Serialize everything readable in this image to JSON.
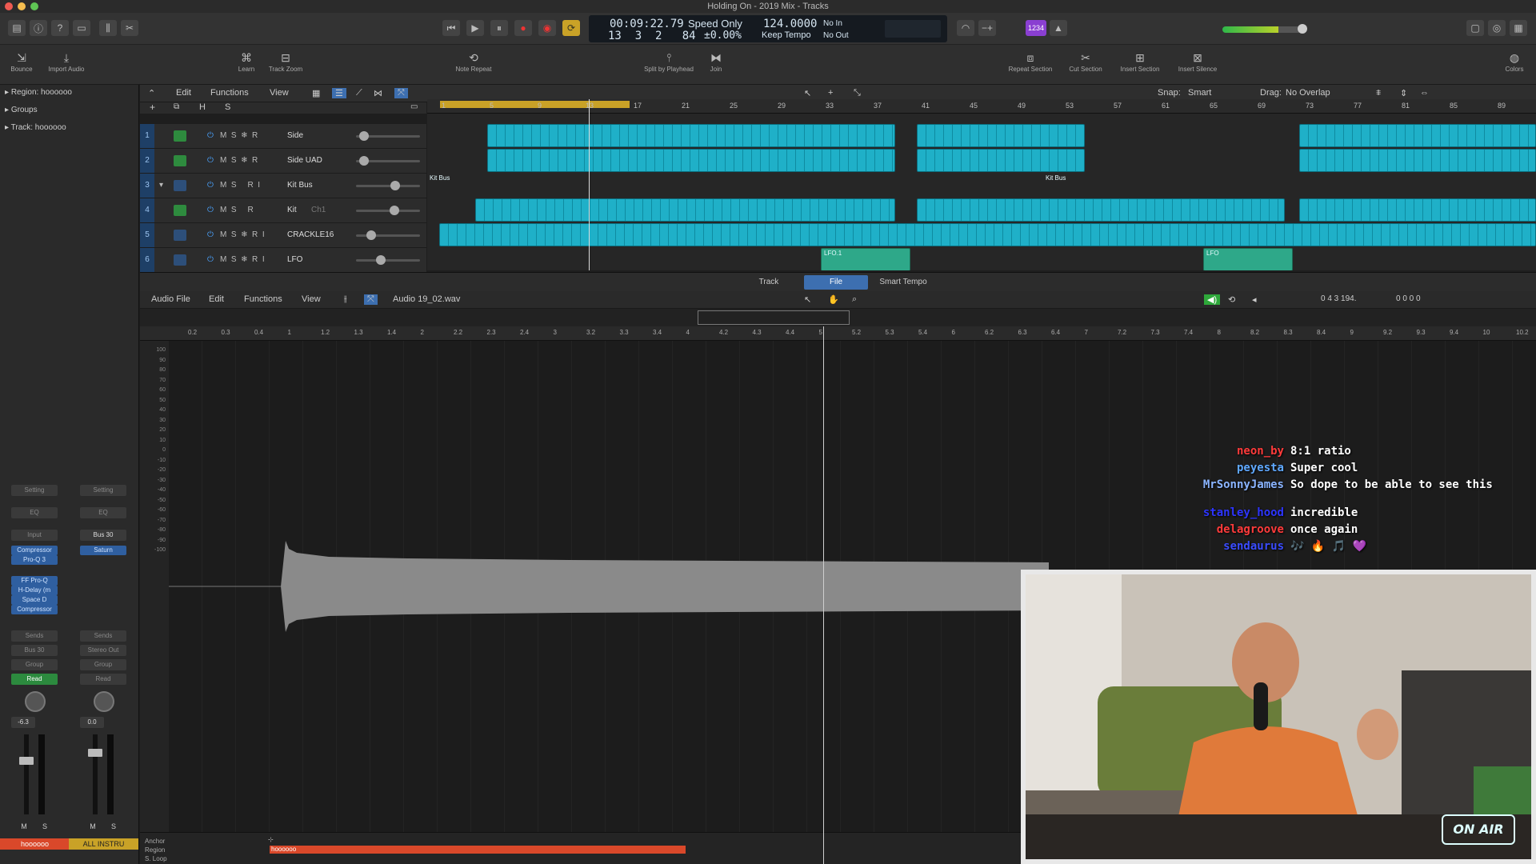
{
  "window": {
    "title": "Holding On - 2019 Mix - Tracks"
  },
  "transport": {
    "time": "00:09:22.79",
    "bars": "13  3  2   84",
    "mode": "Speed Only",
    "percent": "±0.00%",
    "tempo": "124.0000",
    "tempo_mode": "Keep Tempo",
    "in": "No In",
    "out": "No Out",
    "count_badge": "1234"
  },
  "toolbar": {
    "items": [
      {
        "label": "Bounce",
        "icon": "bounce-icon"
      },
      {
        "label": "Import Audio",
        "icon": "import-icon"
      },
      {
        "label": "Learn",
        "icon": "learn-icon"
      },
      {
        "label": "Track Zoom",
        "icon": "zoom-icon"
      },
      {
        "label": "Note Repeat",
        "icon": "note-repeat-icon"
      },
      {
        "label": "Split by Playhead",
        "icon": "split-icon"
      },
      {
        "label": "Join",
        "icon": "join-icon"
      },
      {
        "label": "Repeat Section",
        "icon": "repeat-icon"
      },
      {
        "label": "Cut Section",
        "icon": "cut-icon"
      },
      {
        "label": "Insert Section",
        "icon": "insert-icon"
      },
      {
        "label": "Insert Silence",
        "icon": "silence-icon"
      },
      {
        "label": "Colors",
        "icon": "colors-icon"
      }
    ]
  },
  "inspector": {
    "region": "Region: hoooooo",
    "groups": "Groups",
    "track": "Track: hoooooo",
    "strip1": {
      "setting": "Setting",
      "eq": "EQ",
      "input": "Input",
      "plugins": [
        "Compressor",
        "Pro-Q 3"
      ],
      "inserts": [
        "FF Pro-Q",
        "H-Delay (m",
        "Space D",
        "Compressor"
      ],
      "sends": "Sends",
      "output": "Bus 30",
      "group": "Group",
      "automation": "Read",
      "vol": "-6.3",
      "m": "M",
      "s": "S",
      "name": "hoooooo"
    },
    "strip2": {
      "setting": "Setting",
      "eq": "EQ",
      "input": "Bus 30",
      "plugins": [
        "Saturn"
      ],
      "sends": "Sends",
      "output": "Stereo Out",
      "group": "Group",
      "automation": "Read",
      "vol": "0.0",
      "m": "M",
      "s": "S",
      "name": "ALL INSTRU"
    }
  },
  "tracks_menu": {
    "edit": "Edit",
    "functions": "Functions",
    "view": "View",
    "snap_label": "Snap:",
    "snap": "Smart",
    "drag_label": "Drag:",
    "drag": "No Overlap",
    "h": "H",
    "s": "S"
  },
  "tracks": [
    {
      "num": "1",
      "name": "Side",
      "type": "midi",
      "vol": 0.05,
      "btns": "M  S  ❄  R"
    },
    {
      "num": "2",
      "name": "Side UAD",
      "type": "midi",
      "vol": 0.05,
      "btns": "M  S  ❄  R"
    },
    {
      "num": "3",
      "name": "Kit Bus",
      "type": "audio",
      "vol": 0.62,
      "btns": "M  S     R  I"
    },
    {
      "num": "4",
      "name": "Kit",
      "type": "midi",
      "vol": 0.6,
      "btns": "M  S     R",
      "sub": "Ch1"
    },
    {
      "num": "5",
      "name": "CRACKLE16",
      "type": "audio",
      "vol": 0.18,
      "btns": "M  S  ❄  R  I"
    },
    {
      "num": "6",
      "name": "LFO",
      "type": "audio",
      "vol": 0.35,
      "btns": "M  S  ❄  R  I"
    }
  ],
  "ruler": [
    "1",
    "5",
    "9",
    "13",
    "17",
    "21",
    "25",
    "29",
    "33",
    "37",
    "41",
    "45",
    "49",
    "53",
    "57",
    "61",
    "65",
    "69",
    "73",
    "77",
    "81",
    "85",
    "89"
  ],
  "region_labels": {
    "kitbus_a": "Kit Bus",
    "kitbus_b": "Kit Bus",
    "lfo_a": "LFO.1",
    "lfo_b": "LFO"
  },
  "editor": {
    "tabs": [
      "Track",
      "File",
      "Smart Tempo"
    ],
    "active_tab": "File",
    "menu": {
      "audio_file": "Audio File",
      "edit": "Edit",
      "functions": "Functions",
      "view": "View",
      "filename": "Audio 19_02.wav",
      "position": "0  4  3  194.",
      "length": "0 0 0  0"
    },
    "ruler": [
      "0.2",
      "0.3",
      "0.4",
      "1",
      "1.2",
      "1.3",
      "1.4",
      "2",
      "2.2",
      "2.3",
      "2.4",
      "3",
      "3.2",
      "3.3",
      "3.4",
      "4",
      "4.2",
      "4.3",
      "4.4",
      "5",
      "5.2",
      "5.3",
      "5.4",
      "6",
      "6.2",
      "6.3",
      "6.4",
      "7",
      "7.2",
      "7.3",
      "7.4",
      "8",
      "8.2",
      "8.3",
      "8.4",
      "9",
      "9.2",
      "9.3",
      "9.4",
      "10",
      "10.2"
    ],
    "y_labels": [
      "100",
      "90",
      "80",
      "70",
      "60",
      "50",
      "40",
      "30",
      "20",
      "10",
      "0",
      "-10",
      "-20",
      "-30",
      "-40",
      "-50",
      "-60",
      "-70",
      "-80",
      "-90",
      "-100"
    ],
    "anchor": "Anchor",
    "region_lbl": "Region",
    "sloop": "S. Loop",
    "region_name": "hoooooo"
  },
  "chat": [
    {
      "user": "neon_by",
      "color": "#ff3b3b",
      "text": "8:1 ratio"
    },
    {
      "user": "peyesta",
      "color": "#5fa8ff",
      "text": "Super cool"
    },
    {
      "user": "MrSonnyJames",
      "color": "#8ab4ff",
      "text": "So dope to be able to see this"
    },
    {
      "user": "stanley_hood",
      "color": "#2d35ff",
      "text": "incredible"
    },
    {
      "user": "delagroove",
      "color": "#ff3b3b",
      "text": "once again"
    },
    {
      "user": "sendaurus",
      "color": "#3a4cff",
      "text": "🎶 🔥 🎵 💜"
    }
  ],
  "webcam": {
    "badge": "ON AIR"
  }
}
